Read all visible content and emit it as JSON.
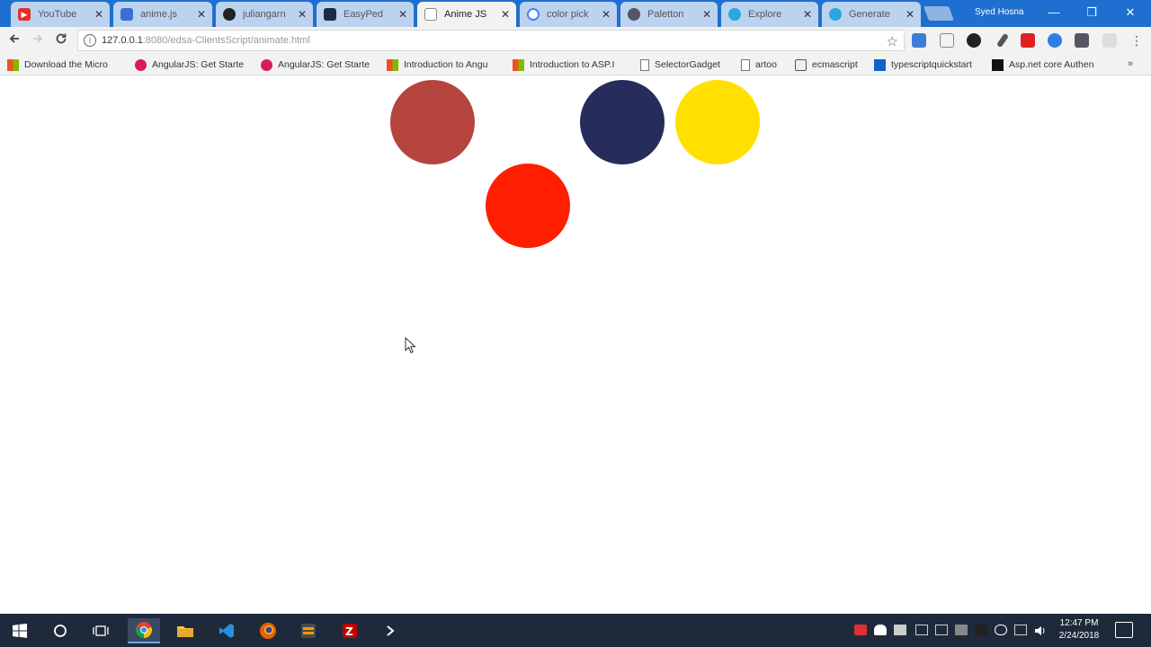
{
  "browser": {
    "tabs": [
      {
        "label": "YouTube",
        "icon": "youtube-icon",
        "color": "#e52d27",
        "active": false
      },
      {
        "label": "anime.js",
        "icon": "animejs-icon",
        "color": "#3a6fd8",
        "active": false
      },
      {
        "label": "juliangarn",
        "icon": "github-icon",
        "color": "#222222",
        "active": false
      },
      {
        "label": "EasyPed",
        "icon": "easyped-icon",
        "color": "#1b2b4a",
        "active": false
      },
      {
        "label": "Anime JS",
        "icon": "page-icon",
        "color": "#ffffff",
        "active": true
      },
      {
        "label": "color pick",
        "icon": "google-icon",
        "color": "#4285f4",
        "active": false
      },
      {
        "label": "Paletton",
        "icon": "paletton-icon",
        "color": "#555566",
        "active": false
      },
      {
        "label": "Explore",
        "icon": "coolors-icon",
        "color": "#2aa6e0",
        "active": false
      },
      {
        "label": "Generate",
        "icon": "coolors-icon",
        "color": "#2aa6e0",
        "active": false
      }
    ],
    "profile_name": "Syed Hosna",
    "window_controls": {
      "minimize": "—",
      "restore": "❐",
      "close": "✕"
    },
    "address": {
      "host": "127.0.0.1",
      "path": ":8080/edsa-ClientsScript/animate.html"
    },
    "bookmarks": [
      {
        "label": "Download the Micro",
        "icon": "microsoft-icon"
      },
      {
        "label": "AngularJS: Get Starte",
        "icon": "angular-icon"
      },
      {
        "label": "AngularJS: Get Starte",
        "icon": "angular-icon"
      },
      {
        "label": "Introduction to Angu",
        "icon": "microsoft-icon"
      },
      {
        "label": "Introduction to ASP.I",
        "icon": "microsoft-icon"
      },
      {
        "label": "SelectorGadget",
        "icon": "page-icon"
      },
      {
        "label": "artoo",
        "icon": "page-icon"
      },
      {
        "label": "ecmascript",
        "icon": "printer-icon"
      },
      {
        "label": "typescriptquickstart",
        "icon": "linkedin-icon"
      },
      {
        "label": "Asp.net core Authen",
        "icon": "dark-icon"
      }
    ],
    "bookmarks_overflow": "»"
  },
  "page": {
    "circles": [
      {
        "name": "circle-brown",
        "color": "#b5443e"
      },
      {
        "name": "circle-red",
        "color": "#ff1e00"
      },
      {
        "name": "circle-navy",
        "color": "#262c5c"
      },
      {
        "name": "circle-yellow",
        "color": "#ffe000"
      }
    ]
  },
  "taskbar": {
    "apps": [
      "windows-start-icon",
      "cortana-search-icon",
      "task-view-icon",
      "chrome-icon",
      "file-explorer-icon",
      "vscode-icon",
      "firefox-icon",
      "sublime-icon",
      "filezilla-icon",
      "powershell-icon"
    ],
    "clock_time": "12:47 PM",
    "clock_date": "2/24/2018"
  }
}
